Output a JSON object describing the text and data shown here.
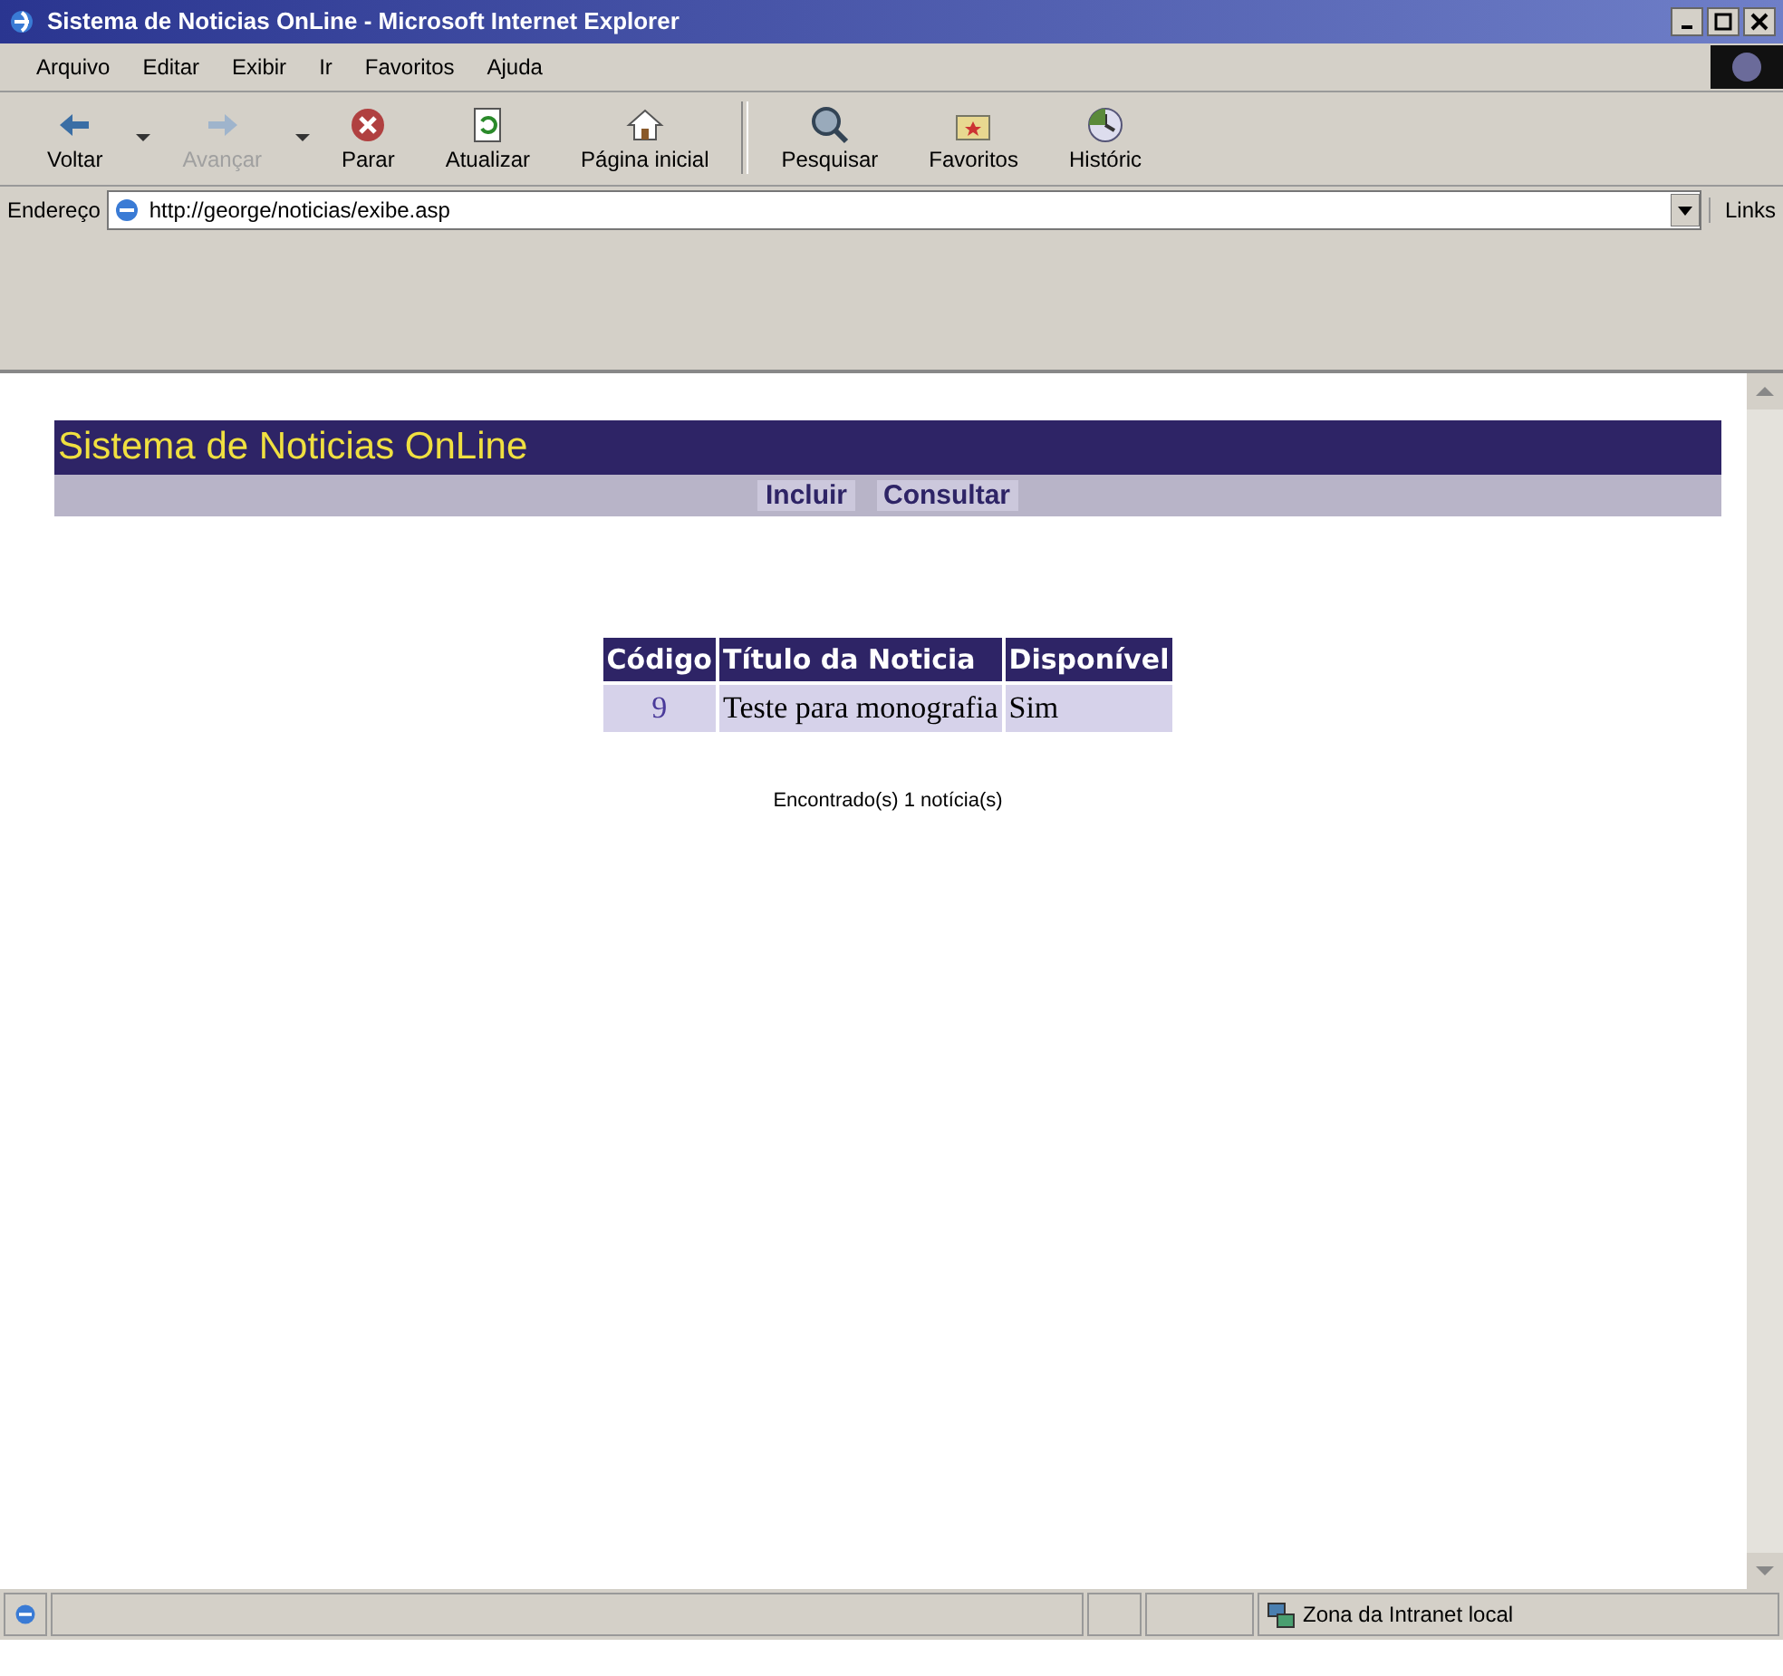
{
  "window": {
    "title": "Sistema de Noticias OnLine - Microsoft Internet Explorer"
  },
  "menu": [
    "Arquivo",
    "Editar",
    "Exibir",
    "Ir",
    "Favoritos",
    "Ajuda"
  ],
  "toolbar": [
    {
      "kind": "back",
      "label": "Voltar",
      "disabled": false,
      "dropdown": true
    },
    {
      "kind": "forward",
      "label": "Avançar",
      "disabled": true,
      "dropdown": true
    },
    {
      "kind": "stop",
      "label": "Parar",
      "disabled": false,
      "dropdown": false
    },
    {
      "kind": "refresh",
      "label": "Atualizar",
      "disabled": false,
      "dropdown": false
    },
    {
      "kind": "home",
      "label": "Página inicial",
      "disabled": false,
      "dropdown": false
    },
    {
      "kind": "search",
      "label": "Pesquisar",
      "disabled": false,
      "dropdown": false
    },
    {
      "kind": "favorites",
      "label": "Favoritos",
      "disabled": false,
      "dropdown": false
    },
    {
      "kind": "history",
      "label": "Históric",
      "disabled": false,
      "dropdown": false
    }
  ],
  "address": {
    "label": "Endereço",
    "value": "http://george/noticias/exibe.asp",
    "links": "Links"
  },
  "page": {
    "title": "Sistema de Noticias OnLine",
    "nav": [
      "Incluir",
      "Consultar"
    ],
    "table": {
      "columns": [
        "Código",
        "Título da Noticia",
        "Disponível"
      ],
      "rows": [
        [
          "9",
          "Teste para monografia",
          "Sim"
        ]
      ]
    },
    "footer": "Encontrado(s) 1 notícia(s)"
  },
  "status_bar": {
    "zone": "Zona da Intranet local"
  }
}
